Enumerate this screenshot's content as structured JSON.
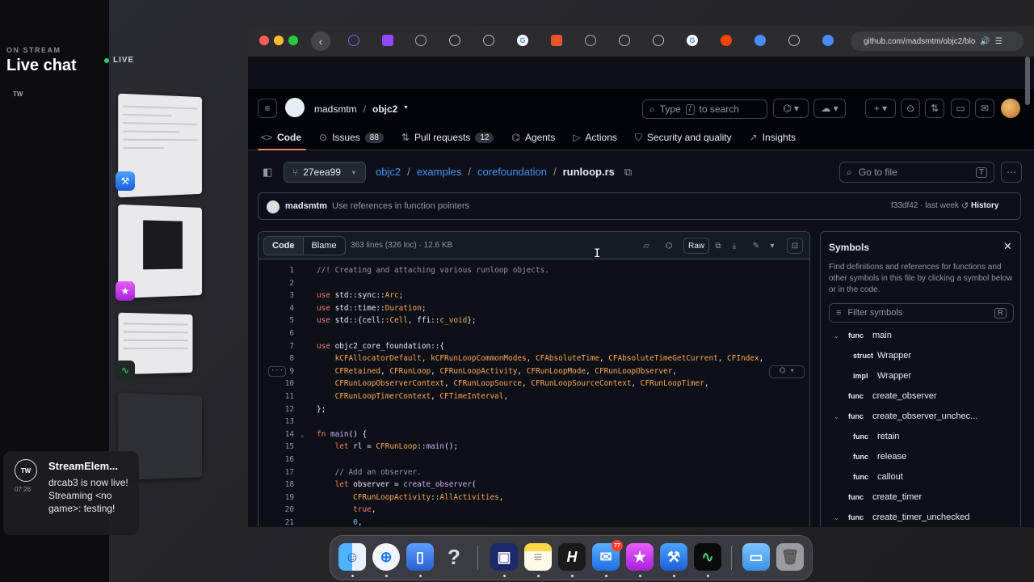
{
  "stream": {
    "on_stream": "ON STREAM",
    "title": "Live chat",
    "live": "LIVE",
    "tw": "TW"
  },
  "notification": {
    "icon": "TW",
    "time": "07:26",
    "title": "StreamElem...",
    "body": "drcab3 is now live! Streaming <no game>: testing!"
  },
  "browser": {
    "url": "github.com/madsmtm/objc2/blo"
  },
  "header": {
    "owner": "madsmtm",
    "slash": "/",
    "repo": "objc2",
    "search_placeholder": "Type",
    "search_key": "/",
    "search_suffix": "to search"
  },
  "nav": {
    "code": "Code",
    "issues": "Issues",
    "issues_count": "88",
    "pulls": "Pull requests",
    "pulls_count": "12",
    "agents": "Agents",
    "actions": "Actions",
    "security": "Security and quality",
    "insights": "Insights"
  },
  "breadcrumb": {
    "branch": "27eea99",
    "parts": [
      "objc2",
      "examples",
      "corefoundation"
    ],
    "file": "runloop.rs",
    "goto_placeholder": "Go to file",
    "goto_key": "T"
  },
  "commit": {
    "author": "madsmtm",
    "message": "Use references in function pointers",
    "meta": "f33df42 · last week",
    "history": "History"
  },
  "code": {
    "tab_code": "Code",
    "tab_blame": "Blame",
    "info": "363 lines (326 loc) · 12.6 KB",
    "raw": "Raw",
    "lines": [
      {
        "n": "1",
        "t": "//! Creating and attaching various runloop objects."
      },
      {
        "n": "2",
        "t": ""
      },
      {
        "n": "3",
        "t": "use std::sync::Arc;"
      },
      {
        "n": "4",
        "t": "use std::time::Duration;"
      },
      {
        "n": "5",
        "t": "use std::{cell::Cell, ffi::c_void};"
      },
      {
        "n": "6",
        "t": ""
      },
      {
        "n": "7",
        "t": "use objc2_core_foundation::{"
      },
      {
        "n": "8",
        "t": "    kCFAllocatorDefault, kCFRunLoopCommonModes, CFAbsoluteTime, CFAbsoluteTimeGetCurrent, CFIndex,"
      },
      {
        "n": "9",
        "t": "    CFRetained, CFRunLoop, CFRunLoopActivity, CFRunLoopMode, CFRunLoopObserver,"
      },
      {
        "n": "10",
        "t": "    CFRunLoopObserverContext, CFRunLoopSource, CFRunLoopSourceContext, CFRunLoopTimer,"
      },
      {
        "n": "11",
        "t": "    CFRunLoopTimerContext, CFTimeInterval,"
      },
      {
        "n": "12",
        "t": "};"
      },
      {
        "n": "13",
        "t": ""
      },
      {
        "n": "14",
        "t": "fn main() {"
      },
      {
        "n": "15",
        "t": "    let rl = CFRunLoop::main();"
      },
      {
        "n": "16",
        "t": ""
      },
      {
        "n": "17",
        "t": "    // Add an observer."
      },
      {
        "n": "18",
        "t": "    let observer = create_observer("
      },
      {
        "n": "19",
        "t": "        CFRunLoopActivity::AllActivities,"
      },
      {
        "n": "20",
        "t": "        true,"
      },
      {
        "n": "21",
        "t": "        0,"
      }
    ]
  },
  "symbols": {
    "title": "Symbols",
    "close": "✕",
    "description": "Find definitions and references for functions and other symbols in this file by clicking a symbol below or in the code.",
    "filter_placeholder": "Filter symbols",
    "filter_key": "R",
    "items": [
      {
        "kind": "func",
        "name": "main",
        "level": 0,
        "chevron": "⌄"
      },
      {
        "kind": "struct",
        "name": "Wrapper",
        "level": 1,
        "chevron": ""
      },
      {
        "kind": "impl",
        "name": "Wrapper",
        "level": 1,
        "chevron": ""
      },
      {
        "kind": "func",
        "name": "create_observer",
        "level": 0,
        "chevron": ""
      },
      {
        "kind": "func",
        "name": "create_observer_unchec...",
        "level": 0,
        "chevron": "⌄"
      },
      {
        "kind": "func",
        "name": "retain",
        "level": 1,
        "chevron": ""
      },
      {
        "kind": "func",
        "name": "release",
        "level": 1,
        "chevron": ""
      },
      {
        "kind": "func",
        "name": "callout",
        "level": 1,
        "chevron": ""
      },
      {
        "kind": "func",
        "name": "create_timer",
        "level": 0,
        "chevron": ""
      },
      {
        "kind": "func",
        "name": "create_timer_unchecked",
        "level": 0,
        "chevron": "⌄"
      }
    ]
  },
  "dock": {
    "mail_badge": "77"
  },
  "colors": {
    "link": "#4493f8",
    "accent_underline": "#f78166",
    "live_green": "#2ecc71"
  }
}
